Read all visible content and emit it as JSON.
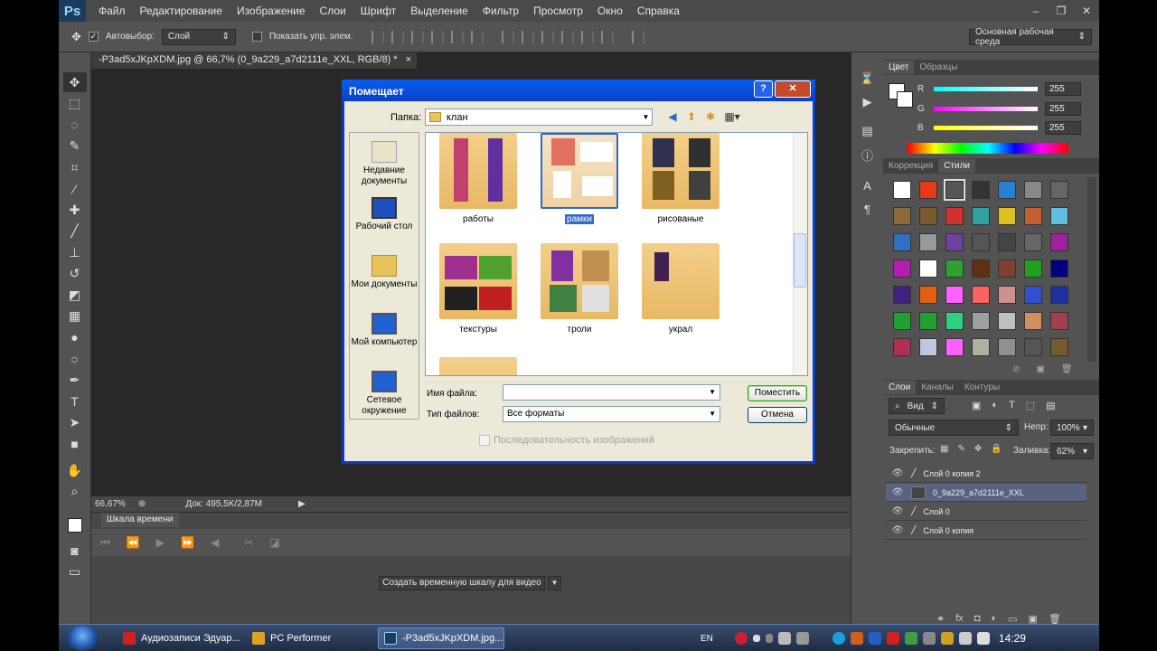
{
  "menubar": {
    "logo": "Ps",
    "items": [
      "Файл",
      "Редактирование",
      "Изображение",
      "Слои",
      "Шрифт",
      "Выделение",
      "Фильтр",
      "Просмотр",
      "Окно",
      "Справка"
    ],
    "min": "–",
    "restore": "❐",
    "close": "✕"
  },
  "options": {
    "autoselect_label": "Автовыбор:",
    "autoselect_value": "Слой",
    "show_controls": "Показать упр. элем.",
    "workspace": "Основная рабочая среда"
  },
  "document": {
    "tab_title": "-P3ad5xJKpXDM.jpg @ 66,7% (0_9a229_a7d2111e_XXL, RGB/8) *",
    "tab_close": "×",
    "zoom": "66,67%",
    "doc_size": "Док: 495,5K/2,87M"
  },
  "timeline": {
    "tab": "Шкала времени",
    "create_button": "Создать временную шкалу для видео"
  },
  "color_panel": {
    "tabs": [
      "Цвет",
      "Образцы"
    ],
    "r_label": "R",
    "g_label": "G",
    "b_label": "B",
    "r_value": "255",
    "g_value": "255",
    "b_value": "255"
  },
  "styles_panel": {
    "tabs": [
      "Коррекция",
      "Стили"
    ],
    "swatches": [
      "#ffffff",
      "#e83a1a",
      "#555555",
      "#333333",
      "#2a7fd0",
      "#888888",
      "#666666",
      "#8a6a3a",
      "#7a5a2a",
      "#d03030",
      "#30a0a0",
      "#e0c020",
      "#c06030",
      "#60c0e0",
      "#3070c0",
      "#999999",
      "#7040a0",
      "#555555",
      "#444444",
      "#666666",
      "#a020a0",
      "#b020b0",
      "#ffffff",
      "#30a030",
      "#603010",
      "#804030",
      "#20a020",
      "#000080",
      "#402080",
      "#e06010",
      "#ff60ff",
      "#ff6060",
      "#d09090",
      "#3050d0",
      "#2030a0",
      "#20a030",
      "#20a030",
      "#30d080",
      "#a0a0a0",
      "#c0c0c0",
      "#d09060",
      "#a04050",
      "#b03050",
      "#c0c8e0",
      "#ff60ff",
      "#b0b0a0",
      "#909090",
      "#555555",
      "#7a5a2a"
    ]
  },
  "layers_panel": {
    "tabs": [
      "Слои",
      "Каналы",
      "Контуры"
    ],
    "filter": "Вид",
    "blend_mode": "Обычные",
    "opacity_label": "Непр:",
    "opacity": "100%",
    "lock_label": "Закрепить:",
    "fill_label": "Заливка:",
    "fill": "62%",
    "layers": [
      {
        "name": "Слой 0 копия 2",
        "selected": false
      },
      {
        "name": "0_9a229_a7d2111e_XXL",
        "selected": true
      },
      {
        "name": "Слой 0",
        "selected": false
      },
      {
        "name": "Слой 0 копия",
        "selected": false
      }
    ]
  },
  "dialog": {
    "title": "Помещает",
    "help": "?",
    "close": "✕",
    "folder_label": "Папка:",
    "folder_value": "клан",
    "places": [
      "Недавние документы",
      "Рабочий стол",
      "Мои документы",
      "Мой компьютер",
      "Сетевое окружение"
    ],
    "folders": [
      {
        "name": "работы",
        "selected": false
      },
      {
        "name": "рамки",
        "selected": true
      },
      {
        "name": "рисованые",
        "selected": false
      },
      {
        "name": "текстуры",
        "selected": false
      },
      {
        "name": "троли",
        "selected": false
      },
      {
        "name": "украл",
        "selected": false
      }
    ],
    "filename_label": "Имя файла:",
    "filename_value": "",
    "filetype_label": "Тип файлов:",
    "filetype_value": "Все форматы",
    "place_button": "Поместить",
    "cancel_button": "Отмена",
    "sequence_label": "Последовательность изображений"
  },
  "taskbar": {
    "tasks": [
      "Аудиозаписи Эдуар...",
      "PC Performer",
      "-P3ad5xJKpXDM.jpg..."
    ],
    "lang": "EN",
    "clock": "14:29"
  }
}
